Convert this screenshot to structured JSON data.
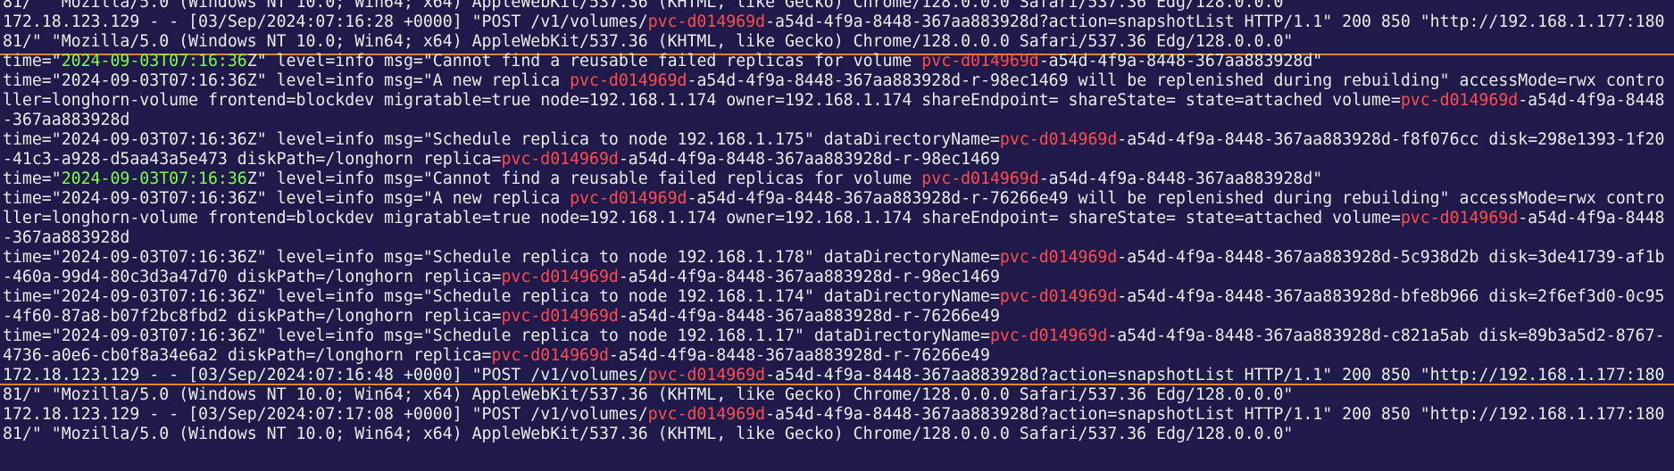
{
  "theme": {
    "background": "#1f1a49",
    "text": "#ebebeb",
    "highlight": "#ff4d4d",
    "timestamp_highlight": "#7dff4a",
    "separator": "#e0852a"
  },
  "lines": [
    {
      "segs": [
        {
          "t": "81/\" \"Mozilla/5.0 (Windows NT 10.0; Win64; x64) AppleWebKit/537.36 (KHTML, like Gecko) Chrome/128.0.0.0 Safari/537.36 Edg/128.0.0.0\""
        }
      ]
    },
    {
      "segs": [
        {
          "t": "172.18.123.129 - - [03/Sep/2024:07:16:28 +0000] \"POST /v1/volumes/"
        },
        {
          "t": "pvc-d014969d",
          "c": "hl"
        },
        {
          "t": "-a54d-4f9a-8448-367aa883928d?action=snapshotList HTTP/1.1\" 200 850 \"http://192.168.1.177:180"
        }
      ]
    },
    {
      "segs": [
        {
          "t": "81/\" \"Mozilla/5.0 (Windows NT 10.0; Win64; x64) AppleWebKit/537.36 (KHTML, like Gecko) Chrome/128.0.0.0 Safari/537.36 Edg/128.0.0.0\""
        }
      ]
    },
    {
      "segs": [
        {
          "t": "time=\""
        },
        {
          "t": "2024-09-03T07:16:36",
          "c": "ts"
        },
        {
          "t": "Z\" level=info msg=\"Cannot find a reusable failed replicas for volume "
        },
        {
          "t": "pvc-d014969d",
          "c": "hl"
        },
        {
          "t": "-a54d-4f9a-8448-367aa883928d\""
        }
      ]
    },
    {
      "segs": [
        {
          "t": "time=\"2024-09-03T07:16:36Z\" level=info msg=\"A new replica "
        },
        {
          "t": "pvc-d014969d",
          "c": "hl"
        },
        {
          "t": "-a54d-4f9a-8448-367aa883928d-r-98ec1469 will be replenished during rebuilding\" accessMode=rwx contro"
        }
      ]
    },
    {
      "segs": [
        {
          "t": "ller=longhorn-volume frontend=blockdev migratable=true node=192.168.1.174 owner=192.168.1.174 shareEndpoint= shareState= state=attached volume="
        },
        {
          "t": "pvc-d014969d",
          "c": "hl"
        },
        {
          "t": "-a54d-4f9a-8448"
        }
      ]
    },
    {
      "segs": [
        {
          "t": "-367aa883928d"
        }
      ]
    },
    {
      "segs": [
        {
          "t": "time=\"2024-09-03T07:16:36Z\" level=info msg=\"Schedule replica to node 192.168.1.175\" dataDirectoryName="
        },
        {
          "t": "pvc-d014969d",
          "c": "hl"
        },
        {
          "t": "-a54d-4f9a-8448-367aa883928d-f8f076cc disk=298e1393-1f20"
        }
      ]
    },
    {
      "segs": [
        {
          "t": "-41c3-a928-d5aa43a5e473 diskPath=/longhorn replica="
        },
        {
          "t": "pvc-d014969d",
          "c": "hl"
        },
        {
          "t": "-a54d-4f9a-8448-367aa883928d-r-98ec1469"
        }
      ]
    },
    {
      "segs": [
        {
          "t": "time=\""
        },
        {
          "t": "2024-09-03T07:16:36",
          "c": "ts"
        },
        {
          "t": "Z\" level=info msg=\"Cannot find a reusable failed replicas for volume "
        },
        {
          "t": "pvc-d014969d",
          "c": "hl"
        },
        {
          "t": "-a54d-4f9a-8448-367aa883928d\""
        }
      ]
    },
    {
      "segs": [
        {
          "t": "time=\"2024-09-03T07:16:36Z\" level=info msg=\"A new replica "
        },
        {
          "t": "pvc-d014969d",
          "c": "hl"
        },
        {
          "t": "-a54d-4f9a-8448-367aa883928d-r-76266e49 will be replenished during rebuilding\" accessMode=rwx contro"
        }
      ]
    },
    {
      "segs": [
        {
          "t": "ller=longhorn-volume frontend=blockdev migratable=true node=192.168.1.174 owner=192.168.1.174 shareEndpoint= shareState= state=attached volume="
        },
        {
          "t": "pvc-d014969d",
          "c": "hl"
        },
        {
          "t": "-a54d-4f9a-8448"
        }
      ]
    },
    {
      "segs": [
        {
          "t": "-367aa883928d"
        }
      ]
    },
    {
      "segs": [
        {
          "t": "time=\"2024-09-03T07:16:36Z\" level=info msg=\"Schedule replica to node 192.168.1.178\" dataDirectoryName="
        },
        {
          "t": "pvc-d014969d",
          "c": "hl"
        },
        {
          "t": "-a54d-4f9a-8448-367aa883928d-5c938d2b disk=3de41739-af1b"
        }
      ]
    },
    {
      "segs": [
        {
          "t": "-460a-99d4-80c3d3a47d70 diskPath=/longhorn replica="
        },
        {
          "t": "pvc-d014969d",
          "c": "hl"
        },
        {
          "t": "-a54d-4f9a-8448-367aa883928d-r-98ec1469"
        }
      ]
    },
    {
      "segs": [
        {
          "t": "time=\"2024-09-03T07:16:36Z\" level=info msg=\"Schedule replica to node 192.168.1.174\" dataDirectoryName="
        },
        {
          "t": "pvc-d014969d",
          "c": "hl"
        },
        {
          "t": "-a54d-4f9a-8448-367aa883928d-bfe8b966 disk=2f6ef3d0-0c95"
        }
      ]
    },
    {
      "segs": [
        {
          "t": "-4f60-87a8-b07f2bc8fbd2 diskPath=/longhorn replica="
        },
        {
          "t": "pvc-d014969d",
          "c": "hl"
        },
        {
          "t": "-a54d-4f9a-8448-367aa883928d-r-76266e49"
        }
      ]
    },
    {
      "segs": [
        {
          "t": "time=\"2024-09-03T07:16:36Z\" level=info msg=\"Schedule replica to node 192.168.1.17\" dataDirectoryName="
        },
        {
          "t": "pvc-d014969d",
          "c": "hl"
        },
        {
          "t": "-a54d-4f9a-8448-367aa883928d-c821a5ab disk=89b3a5d2-8767-"
        }
      ]
    },
    {
      "segs": [
        {
          "t": "4736-a0e6-cb0f8a34e6a2 diskPath=/longhorn replica="
        },
        {
          "t": "pvc-d014969d",
          "c": "hl"
        },
        {
          "t": "-a54d-4f9a-8448-367aa883928d-r-76266e49"
        }
      ]
    },
    {
      "segs": [
        {
          "t": "172.18.123.129 - - [03/Sep/2024:07:16:48 +0000] \"POST /v1/volumes/"
        },
        {
          "t": "pvc-d014969d",
          "c": "hl"
        },
        {
          "t": "-a54d-4f9a-8448-367aa883928d?action=snapshotList HTTP/1.1\" 200 850 \"http://192.168.1.177:180"
        }
      ]
    },
    {
      "segs": [
        {
          "t": "81/\" \"Mozilla/5.0 (Windows NT 10.0; Win64; x64) AppleWebKit/537.36 (KHTML, like Gecko) Chrome/128.0.0.0 Safari/537.36 Edg/128.0.0.0\""
        }
      ]
    },
    {
      "segs": [
        {
          "t": "172.18.123.129 - - [03/Sep/2024:07:17:08 +0000] \"POST /v1/volumes/"
        },
        {
          "t": "pvc-d014969d",
          "c": "hl"
        },
        {
          "t": "-a54d-4f9a-8448-367aa883928d?action=snapshotList HTTP/1.1\" 200 850 \"http://192.168.1.177:180"
        }
      ]
    },
    {
      "segs": [
        {
          "t": "81/\" \"Mozilla/5.0 (Windows NT 10.0; Win64; x64) AppleWebKit/537.36 (KHTML, like Gecko) Chrome/128.0.0.0 Safari/537.36 Edg/128.0.0.0\""
        }
      ]
    }
  ]
}
